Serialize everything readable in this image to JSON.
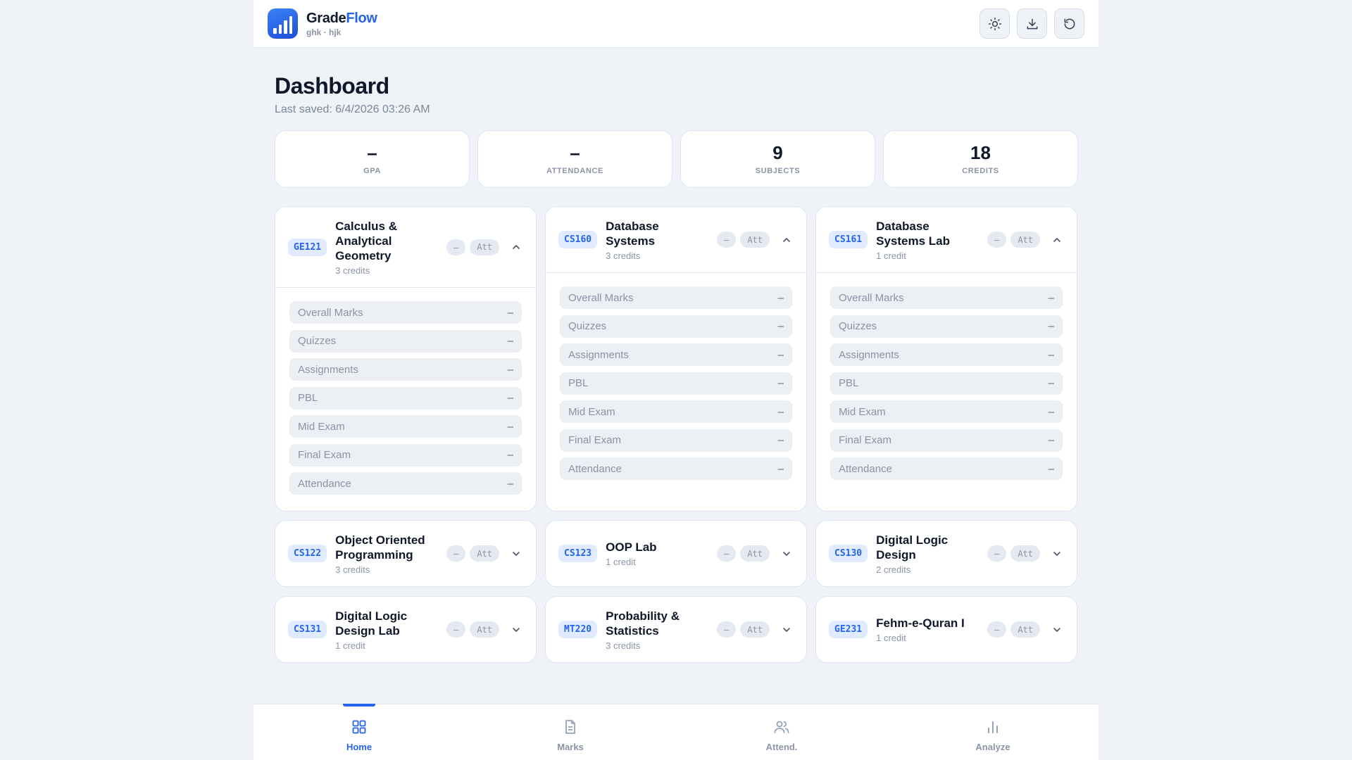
{
  "app": {
    "brand_part1": "Grade",
    "brand_part2": "Flow",
    "subtitle": "ghk · hjk"
  },
  "header_actions": [
    "sun-icon",
    "download-icon",
    "reset-icon"
  ],
  "page": {
    "title": "Dashboard",
    "last_saved": "Last saved: 6/4/2026 03:26 AM"
  },
  "stats": [
    {
      "value": "–",
      "label": "GPA"
    },
    {
      "value": "–",
      "label": "ATTENDANCE"
    },
    {
      "value": "9",
      "label": "SUBJECTS"
    },
    {
      "value": "18",
      "label": "CREDITS"
    }
  ],
  "subject_pill": {
    "grade": "–",
    "att": "Att"
  },
  "subjects": [
    {
      "code": "GE121",
      "name": "Calculus & Analytical Geometry",
      "credits": "3 credits",
      "expanded": true
    },
    {
      "code": "CS160",
      "name": "Database Systems",
      "credits": "3 credits",
      "expanded": true
    },
    {
      "code": "CS161",
      "name": "Database Systems Lab",
      "credits": "1 credit",
      "expanded": true
    },
    {
      "code": "CS122",
      "name": "Object Oriented Programming",
      "credits": "3 credits",
      "expanded": false
    },
    {
      "code": "CS123",
      "name": "OOP Lab",
      "credits": "1 credit",
      "expanded": false
    },
    {
      "code": "CS130",
      "name": "Digital Logic Design",
      "credits": "2 credits",
      "expanded": false
    },
    {
      "code": "CS131",
      "name": "Digital Logic Design Lab",
      "credits": "1 credit",
      "expanded": false
    },
    {
      "code": "MT220",
      "name": "Probability & Statistics",
      "credits": "3 credits",
      "expanded": false
    },
    {
      "code": "GE231",
      "name": "Fehm-e-Quran I",
      "credits": "1 credit",
      "expanded": false
    }
  ],
  "components": [
    "Overall Marks",
    "Quizzes",
    "Assignments",
    "PBL",
    "Mid Exam",
    "Final Exam",
    "Attendance"
  ],
  "component_value": "–",
  "nav": [
    {
      "label": "Home",
      "icon": "grid-icon",
      "active": true
    },
    {
      "label": "Marks",
      "icon": "document-icon",
      "active": false
    },
    {
      "label": "Attend.",
      "icon": "users-icon",
      "active": false
    },
    {
      "label": "Analyze",
      "icon": "bar-chart-icon",
      "active": false
    }
  ],
  "colors": {
    "accent": "#2563eb",
    "background": "#eef2f7",
    "muted_text": "#8a94a6"
  }
}
